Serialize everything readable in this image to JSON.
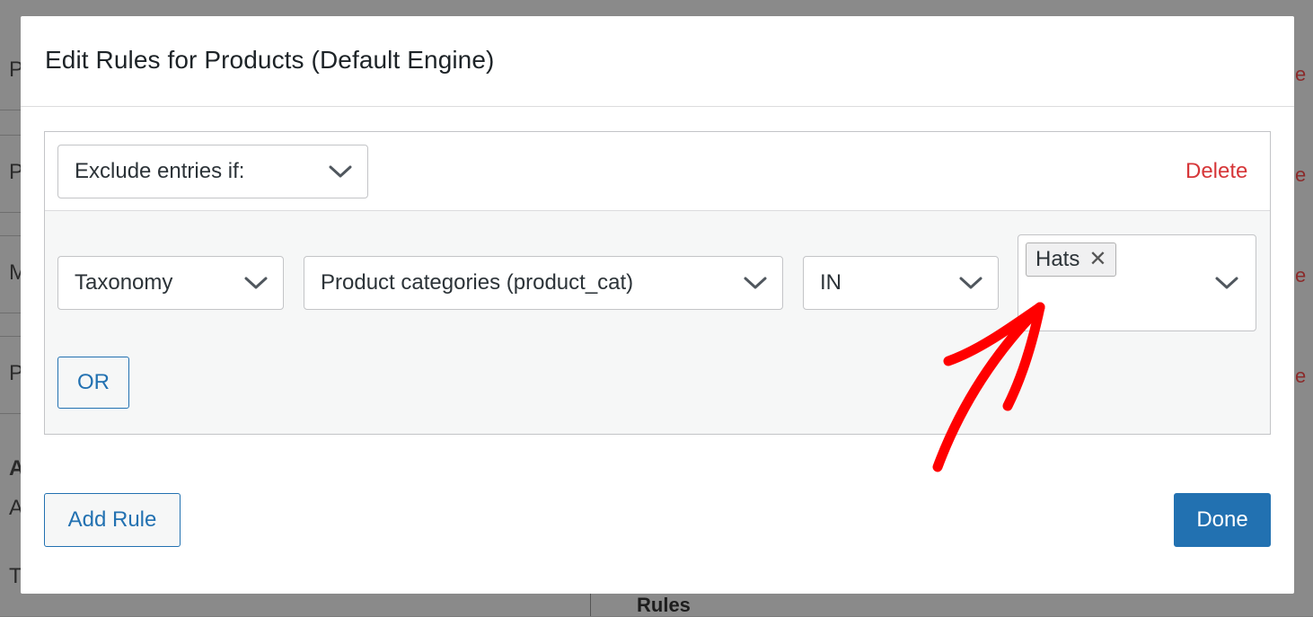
{
  "background": {
    "left_letters": [
      "P",
      "P",
      "M",
      "P",
      "A",
      "A",
      "T"
    ],
    "right_letters": [
      "e",
      "e",
      "e",
      "e"
    ],
    "bottom_label": "Rules"
  },
  "modal": {
    "title": "Edit Rules for Products (Default Engine)",
    "rule": {
      "mode_select": "Exclude entries if:",
      "delete_label": "Delete",
      "condition": {
        "type_select": "Taxonomy",
        "taxonomy_select": "Product categories (product_cat)",
        "operator_select": "IN",
        "values": [
          "Hats"
        ]
      },
      "or_label": "OR"
    },
    "add_rule_label": "Add Rule",
    "done_label": "Done"
  },
  "colors": {
    "accent": "#2271b1",
    "danger": "#d63638",
    "annotation_arrow": "#ff0000"
  },
  "icons": {
    "select_arrow": "chevron-down-icon",
    "remove_tag": "close-icon"
  }
}
